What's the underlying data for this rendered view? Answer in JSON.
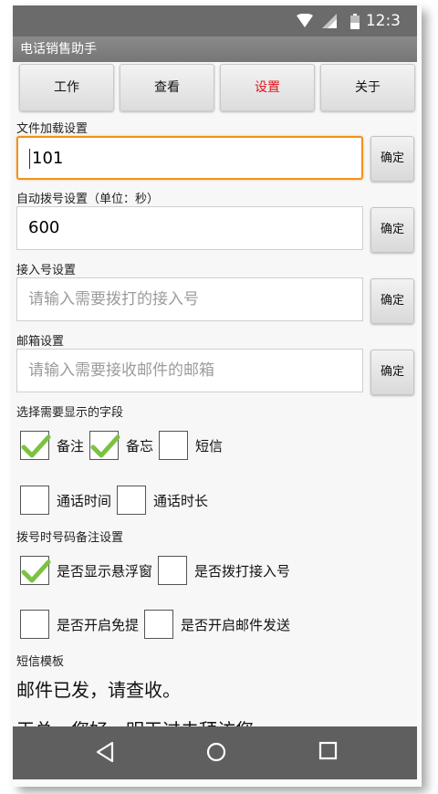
{
  "status_bar": {
    "time": "12:3",
    "icons": [
      "wifi-icon",
      "signal-icon",
      "battery-icon"
    ]
  },
  "app": {
    "title": "电话销售助手"
  },
  "tabs": [
    {
      "label": "工作",
      "active": false
    },
    {
      "label": "查看",
      "active": false
    },
    {
      "label": "设置",
      "active": true
    },
    {
      "label": "关于",
      "active": false
    }
  ],
  "settings": {
    "file_load": {
      "label": "文件加载设置",
      "value": "101",
      "confirm": "确定"
    },
    "auto_dial": {
      "label": "自动拨号设置（单位：秒）",
      "value": "600",
      "confirm": "确定"
    },
    "access_number": {
      "label": "接入号设置",
      "placeholder": "请输入需要拨打的接入号",
      "confirm": "确定"
    },
    "email": {
      "label": "邮箱设置",
      "placeholder": "请输入需要接收邮件的邮箱",
      "confirm": "确定"
    }
  },
  "display_fields": {
    "label": "选择需要显示的字段",
    "options": [
      {
        "label": "备注",
        "checked": true
      },
      {
        "label": "备忘",
        "checked": true
      },
      {
        "label": "短信",
        "checked": false
      },
      {
        "label": "通话时间",
        "checked": false
      },
      {
        "label": "通话时长",
        "checked": false
      }
    ]
  },
  "dial_remark": {
    "label": "拨号时号码备注设置",
    "options": [
      {
        "label": "是否显示悬浮窗",
        "checked": true
      },
      {
        "label": "是否拨打接入号",
        "checked": false
      },
      {
        "label": "是否开启免提",
        "checked": false
      },
      {
        "label": "是否开启邮件发送",
        "checked": false
      }
    ]
  },
  "sms_template": {
    "label": "短信模板",
    "line1": "邮件已发，请查收。",
    "line2": "王总，您好，明天过去拜访您。"
  },
  "colors": {
    "accent": "#e0161c",
    "focus": "#f0921e",
    "check": "#7cc242",
    "titlebar": "#7a7a7a",
    "navbar": "#5f5f5f"
  },
  "nav": [
    "back-icon",
    "home-icon",
    "recents-icon"
  ]
}
